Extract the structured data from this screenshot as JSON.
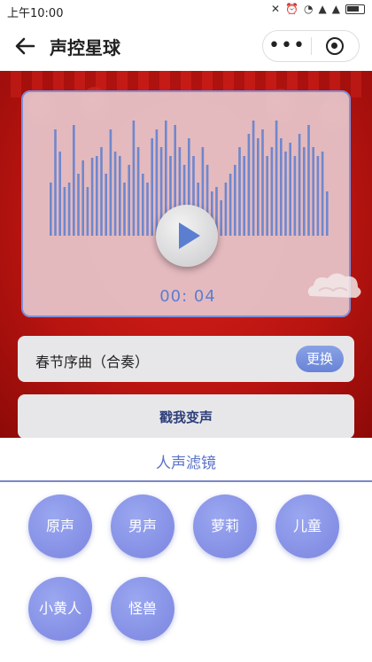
{
  "status": {
    "time": "上午10:00"
  },
  "nav": {
    "title": "声控星球",
    "more_icon": "more-dots-icon",
    "record_icon": "record-icon",
    "back_icon": "back-arrow-icon"
  },
  "player": {
    "timer": "00: 04",
    "play_icon": "play-icon",
    "accent_color": "#5b7ed0"
  },
  "song": {
    "name": "春节序曲（合奏）",
    "change_label": "更换"
  },
  "action": {
    "label": "戳我变声"
  },
  "filters": {
    "title": "人声滤镜",
    "items": [
      {
        "label": "原声"
      },
      {
        "label": "男声"
      },
      {
        "label": "萝莉"
      },
      {
        "label": "儿童"
      },
      {
        "label": "小黄人"
      },
      {
        "label": "怪兽"
      }
    ]
  }
}
